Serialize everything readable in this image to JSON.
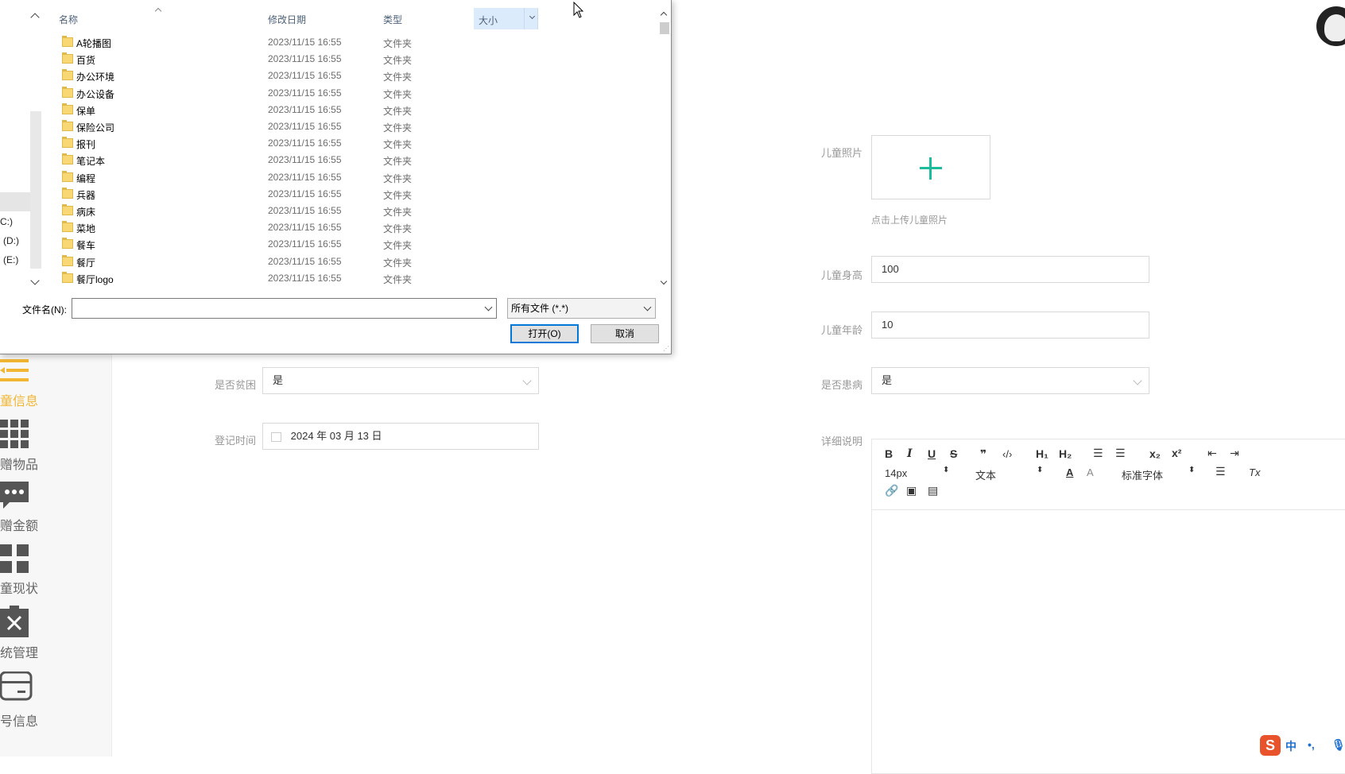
{
  "sidebar": {
    "items": [
      {
        "label": "童信息",
        "icon": "list-icon",
        "active": true
      },
      {
        "label": "赠物品",
        "icon": "grid-icon",
        "active": false
      },
      {
        "label": "赠金额",
        "icon": "chat-icon",
        "active": false
      },
      {
        "label": "童现状",
        "icon": "dashboard-icon",
        "active": false
      },
      {
        "label": "统管理",
        "icon": "clipboard-x-icon",
        "active": false
      },
      {
        "label": "号信息",
        "icon": "card-icon",
        "active": false
      }
    ]
  },
  "form": {
    "photo_label": "儿童照片",
    "photo_hint": "点击上传儿童照片",
    "height_label": "儿童身高",
    "height_value": "100",
    "age_label": "儿童年龄",
    "age_value": "10",
    "ill_label": "是否患病",
    "ill_value": "是",
    "poor_label": "是否贫困",
    "poor_value": "是",
    "date_label": "登记时间",
    "date_value": "2024 年 03 月 13 日",
    "detail_label": "详细说明"
  },
  "editor": {
    "font_size": "14px",
    "paragraph": "文本",
    "font_family": "标准字体",
    "buttons": {
      "bold": "B",
      "italic": "I",
      "underline": "U",
      "strike": "S",
      "quote": "❞",
      "code": "‹/›",
      "h1": "H₁",
      "h2": "H₂",
      "sub": "x₂",
      "sup": "x²",
      "color": "A",
      "bg": "A",
      "clear": "Tx"
    }
  },
  "ime": {
    "lang": "中",
    "punct": "•,"
  },
  "dialog": {
    "columns": {
      "name": "名称",
      "date": "修改日期",
      "type": "类型",
      "size": "大小"
    },
    "nav": [
      {
        "label": "C:)"
      },
      {
        "label": "(D:)"
      },
      {
        "label": "(E:)"
      }
    ],
    "rows": [
      {
        "name": "A轮播图",
        "date": "2023/11/15 16:55",
        "type": "文件夹"
      },
      {
        "name": "百货",
        "date": "2023/11/15 16:55",
        "type": "文件夹"
      },
      {
        "name": "办公环境",
        "date": "2023/11/15 16:55",
        "type": "文件夹"
      },
      {
        "name": "办公设备",
        "date": "2023/11/15 16:55",
        "type": "文件夹"
      },
      {
        "name": "保单",
        "date": "2023/11/15 16:55",
        "type": "文件夹"
      },
      {
        "name": "保险公司",
        "date": "2023/11/15 16:55",
        "type": "文件夹"
      },
      {
        "name": "报刊",
        "date": "2023/11/15 16:55",
        "type": "文件夹"
      },
      {
        "name": "笔记本",
        "date": "2023/11/15 16:55",
        "type": "文件夹"
      },
      {
        "name": "编程",
        "date": "2023/11/15 16:55",
        "type": "文件夹"
      },
      {
        "name": "兵器",
        "date": "2023/11/15 16:55",
        "type": "文件夹"
      },
      {
        "name": "病床",
        "date": "2023/11/15 16:55",
        "type": "文件夹"
      },
      {
        "name": "菜地",
        "date": "2023/11/15 16:55",
        "type": "文件夹"
      },
      {
        "name": "餐车",
        "date": "2023/11/15 16:55",
        "type": "文件夹"
      },
      {
        "name": "餐厅",
        "date": "2023/11/15 16:55",
        "type": "文件夹"
      },
      {
        "name": "餐厅logo",
        "date": "2023/11/15 16:55",
        "type": "文件夹"
      }
    ],
    "filename_label": "文件名(N):",
    "filename_value": "",
    "filter_value": "所有文件 (*.*)",
    "open_button": "打开(O)",
    "cancel_button": "取消"
  },
  "colors": {
    "accent": "#f2b632",
    "upload_plus": "#1abc9c",
    "dialog_primary": "#0078d7"
  }
}
